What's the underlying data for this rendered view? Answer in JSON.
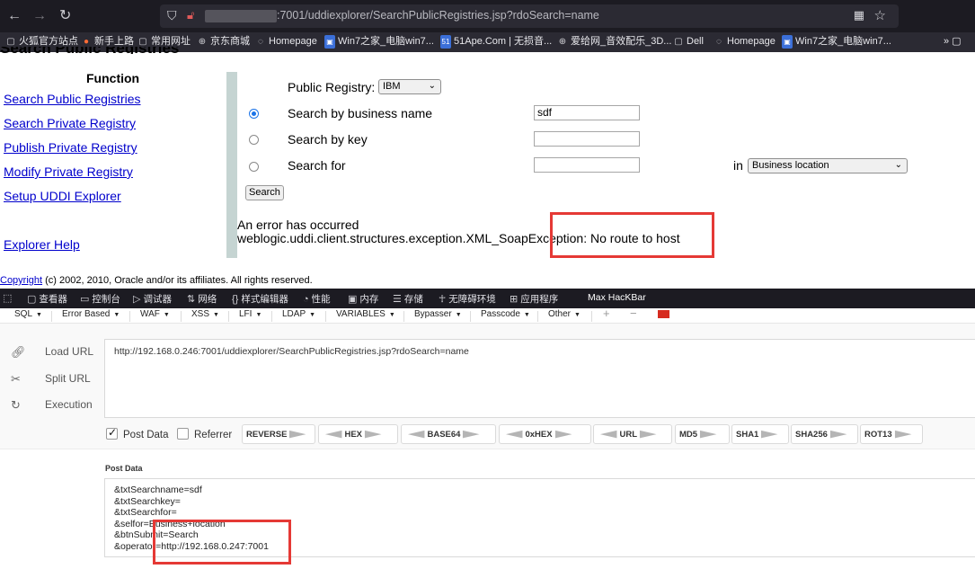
{
  "browser": {
    "url": ":7001/uddiexplorer/SearchPublicRegistries.jsp?rdoSearch=name",
    "bookmarks": [
      "火狐官方站点",
      "新手上路",
      "常用网址",
      "京东商城",
      "Homepage",
      "Win7之家_电脑win7...",
      "51Ape.Com | 无损音...",
      "爱给网_音效配乐_3D...",
      "Dell",
      "Homepage",
      "Win7之家_电脑win7..."
    ]
  },
  "page": {
    "title_partial": "Search Public Registries",
    "function_heading": "Function",
    "nav_links": [
      "Search Public Registries",
      "Search Private Registry",
      "Publish Private Registry",
      "Modify Private Registry",
      "Setup UDDI Explorer",
      "Explorer Help"
    ],
    "public_registry_label": "Public Registry:",
    "public_registry_value": "IBM",
    "search_by_name_label": "Search by business name",
    "search_by_name_value": "sdf",
    "search_by_key_label": "Search by key",
    "search_for_label": "Search for",
    "in_label": "in",
    "search_for_scope": "Business location",
    "search_button": "Search",
    "error_line1": "An error has occurred",
    "error_line2": "weblogic.uddi.client.structures.exception.XML_SoapException: No route to host",
    "copyright_link": "Copyright",
    "copyright_rest": "(c) 2002, 2010, Oracle and/or its affiliates. All rights reserved."
  },
  "devtools": {
    "tabs": [
      "查看器",
      "控制台",
      "调试器",
      "网络",
      "样式编辑器",
      "性能",
      "内存",
      "存储",
      "无障碍环境",
      "应用程序",
      "Max HacKBar"
    ],
    "menus": [
      "SQL",
      "Error Based",
      "WAF",
      "XSS",
      "LFI",
      "LDAP",
      "VARIABLES",
      "Bypasser",
      "Passcode",
      "Other"
    ],
    "actions": [
      "Load URL",
      "Split URL",
      "Execution"
    ],
    "url_value": "http://192.168.0.246:7001/uddiexplorer/SearchPublicRegistries.jsp?rdoSearch=name",
    "post_data_option": "Post Data",
    "referrer_option": "Referrer",
    "encoders": [
      "REVERSE",
      "HEX",
      "BASE64",
      "0xHEX",
      "URL",
      "MD5",
      "SHA1",
      "SHA256",
      "ROT13"
    ],
    "post_data_label": "Post Data",
    "post_lines": [
      "&txtSearchname=sdf",
      "&txtSearchkey=",
      "&txtSearchfor=",
      "&selfor=Business+location",
      "&btnSubmit=Search",
      "&operator=http://192.168.0.247:7001"
    ]
  },
  "colors": {
    "highlight_box": "#e53935",
    "link": "#0000cc",
    "sidebar_bar": "#c5d4d2"
  }
}
